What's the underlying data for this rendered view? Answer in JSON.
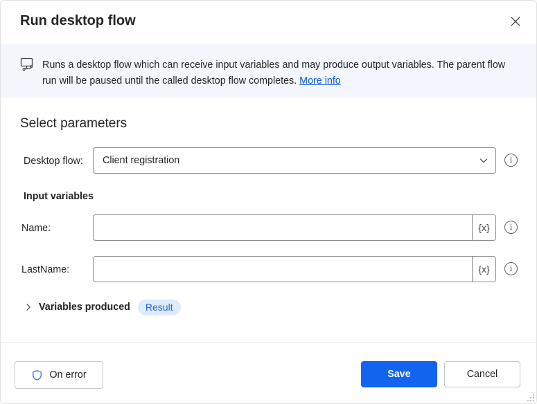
{
  "dialog": {
    "title": "Run desktop flow",
    "close_label": "Close"
  },
  "banner": {
    "icon": "desktop-flow-icon",
    "text": "Runs a desktop flow which can receive input variables and may produce output variables. The parent flow run will be paused until the called desktop flow completes.",
    "link_label": "More info"
  },
  "body": {
    "section_title": "Select parameters",
    "desktop_flow": {
      "label": "Desktop flow:",
      "value": "Client registration",
      "chevron": "chevron-down-icon",
      "info": "i"
    },
    "input_variables_label": "Input variables",
    "fields": [
      {
        "label": "Name:",
        "value": "",
        "placeholder": "",
        "var_button": "{x}",
        "info": "i"
      },
      {
        "label": "LastName:",
        "value": "",
        "placeholder": "",
        "var_button": "{x}",
        "info": "i"
      }
    ],
    "variables_produced": {
      "label": "Variables produced",
      "pill": "Result",
      "expander": "chevron-right-icon"
    }
  },
  "footer": {
    "on_error": "On error",
    "save": "Save",
    "cancel": "Cancel"
  },
  "colors": {
    "accent": "#1264f0",
    "banner_bg": "#f3f7fd",
    "link": "#0f58d6",
    "pill_bg": "#ddebfb",
    "pill_text": "#2266e3",
    "border": "#8a8886"
  }
}
